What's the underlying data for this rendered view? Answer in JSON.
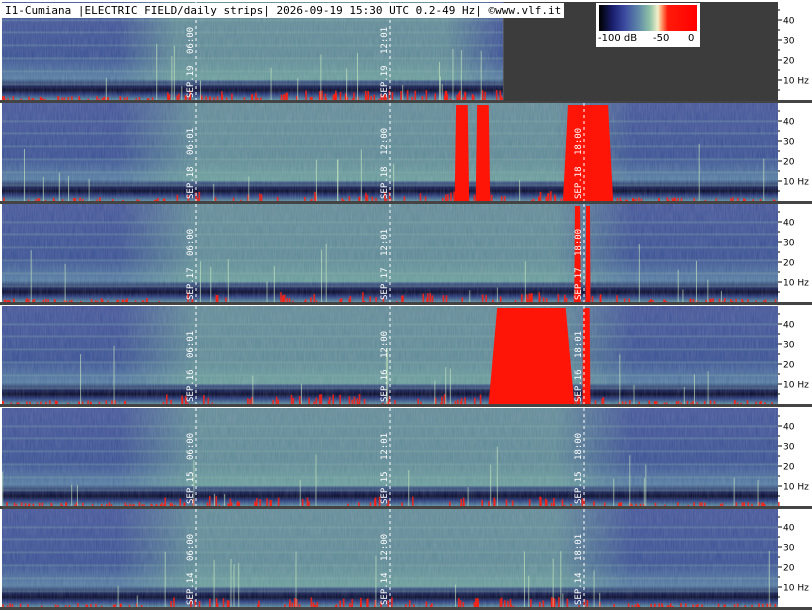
{
  "header": {
    "title": "I1-Cumiana |ELECTRIC FIELD/daily strips| 2026-09-19 15:30 UTC 0.2-49 Hz| ©www.vlf.it"
  },
  "legend": {
    "labels": [
      "-100 dB",
      "-50",
      "0"
    ]
  },
  "chart_data": {
    "type": "heatmap",
    "title": "I1-Cumiana |ELECTRIC FIELD/daily strips| 2026-09-19 15:30 UTC 0.2-49 Hz| ©www.vlf.it",
    "xlabel": "",
    "ylabel": "",
    "colorscale": {
      "min": -100,
      "max": 0,
      "unit": "dB",
      "tick_labels": [
        "-100 dB",
        "-50",
        "0"
      ]
    },
    "y_ticks": [
      "40",
      "30",
      "20",
      "10 Hz"
    ],
    "y_tick_values": [
      40,
      30,
      20,
      10
    ],
    "ylim": [
      0.2,
      49
    ],
    "hours_per_strip": 24,
    "strips": [
      {
        "date": "SEP.19",
        "markers": [
          {
            "hour": 6,
            "label": "06:00"
          },
          {
            "hour": 12,
            "label": "12:01"
          }
        ],
        "data_until_hour": 15.5,
        "red_blocks": []
      },
      {
        "date": "SEP.18",
        "markers": [
          {
            "hour": 6,
            "label": "06:01"
          },
          {
            "hour": 12,
            "label": "12:00"
          },
          {
            "hour": 18,
            "label": "18:00"
          }
        ],
        "data_until_hour": 24,
        "red_blocks": [
          [
            14.0,
            14.45
          ],
          [
            14.65,
            15.1
          ],
          [
            17.35,
            18.9
          ]
        ]
      },
      {
        "date": "SEP.17",
        "markers": [
          {
            "hour": 6,
            "label": "06:00"
          },
          {
            "hour": 12,
            "label": "12:01"
          },
          {
            "hour": 18,
            "label": "18:00"
          }
        ],
        "data_until_hour": 24,
        "red_blocks": [
          [
            17.7,
            17.9
          ],
          [
            18.05,
            18.2
          ]
        ]
      },
      {
        "date": "SEP.16",
        "markers": [
          {
            "hour": 6,
            "label": "06:01"
          },
          {
            "hour": 12,
            "label": "12:00"
          },
          {
            "hour": 18,
            "label": "18:01"
          }
        ],
        "data_until_hour": 24,
        "red_blocks": [
          [
            15.05,
            17.7
          ],
          [
            17.95,
            18.2
          ]
        ]
      },
      {
        "date": "SEP.15",
        "markers": [
          {
            "hour": 6,
            "label": "06:00"
          },
          {
            "hour": 12,
            "label": "12:01"
          },
          {
            "hour": 18,
            "label": "18:00"
          }
        ],
        "data_until_hour": 24,
        "red_blocks": []
      },
      {
        "date": "SEP.14",
        "markers": [
          {
            "hour": 6,
            "label": "06:00"
          },
          {
            "hour": 12,
            "label": "12:00"
          },
          {
            "hour": 18,
            "label": "18:01"
          }
        ],
        "data_until_hour": 24,
        "red_blocks": []
      }
    ]
  }
}
